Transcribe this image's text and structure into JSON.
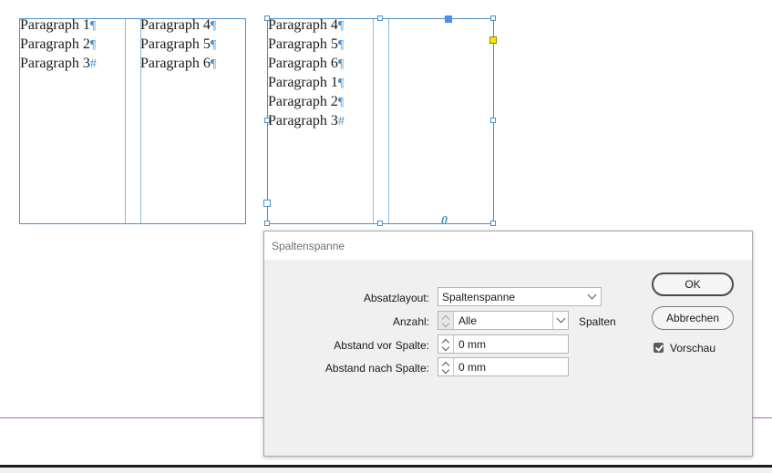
{
  "frame_left": {
    "column1": [
      {
        "text": "Paragraph 1",
        "mark": "¶"
      },
      {
        "text": "Paragraph 2",
        "mark": "¶"
      },
      {
        "text": "Paragraph 3",
        "mark": "#"
      }
    ],
    "column2": [
      {
        "text": "Paragraph 4",
        "mark": "¶"
      },
      {
        "text": "Paragraph 5",
        "mark": "¶"
      },
      {
        "text": "Paragraph 6",
        "mark": "¶"
      }
    ]
  },
  "frame_right": {
    "column1": [
      {
        "text": "Paragraph 4",
        "mark": "¶"
      },
      {
        "text": "Paragraph 5",
        "mark": "¶"
      },
      {
        "text": "Paragraph 6",
        "mark": "¶"
      },
      {
        "text": "Paragraph 1",
        "mark": "¶"
      },
      {
        "text": "Paragraph 2",
        "mark": "¶"
      },
      {
        "text": "Paragraph 3",
        "mark": "#"
      }
    ],
    "overset_glyph": "0"
  },
  "dialog": {
    "title": "Spaltenspanne",
    "fields": {
      "absatzlayout_label": "Absatzlayout:",
      "absatzlayout_value": "Spaltenspanne",
      "anzahl_label": "Anzahl:",
      "anzahl_value": "Alle",
      "anzahl_unit": "Spalten",
      "abstand_vor_label": "Abstand vor Spalte:",
      "abstand_vor_value": "0 mm",
      "abstand_nach_label": "Abstand nach Spalte:",
      "abstand_nach_value": "0 mm"
    },
    "buttons": {
      "ok": "OK",
      "cancel": "Abbrechen"
    },
    "preview": {
      "label": "Vorschau",
      "checked": true
    }
  },
  "colors": {
    "frame": "#4a90c8",
    "guide": "#c060d0",
    "dialog_bg": "#f0f0f0"
  }
}
